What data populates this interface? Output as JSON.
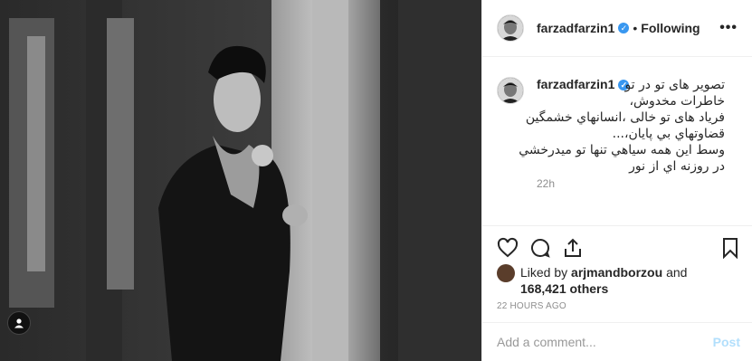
{
  "post": {
    "username": "farzadfarzin1",
    "follow_status": "Following",
    "more_label": "•••",
    "separator": "•",
    "caption": "تصوير هاى تو در تو\nخاطرات مخدوش،\nفرياد هاى تو خالى ،انسانهاي خشمگين\nقضاوتهاي بي پايان،...\nوسط اين همه سياهي تنها تو ميدرخشي\nدر روزنه اي از نور",
    "comment_time": "22h",
    "liked_by_prefix": "Liked by",
    "liked_by_user": "arjmandborzou",
    "liked_by_and": "and",
    "likes_count": "168,421 others",
    "posted_ago": "22 HOURS AGO",
    "comment_placeholder": "Add a comment...",
    "post_label": "Post"
  },
  "icons": {
    "like": "heart-icon",
    "comment": "comment-icon",
    "share": "share-icon",
    "save": "bookmark-icon",
    "verified": "verified-badge-icon",
    "tag": "user-tag-icon"
  },
  "colors": {
    "verified": "#3897f0",
    "post_button": "#b2dffc",
    "muted": "#8e8e8e"
  }
}
